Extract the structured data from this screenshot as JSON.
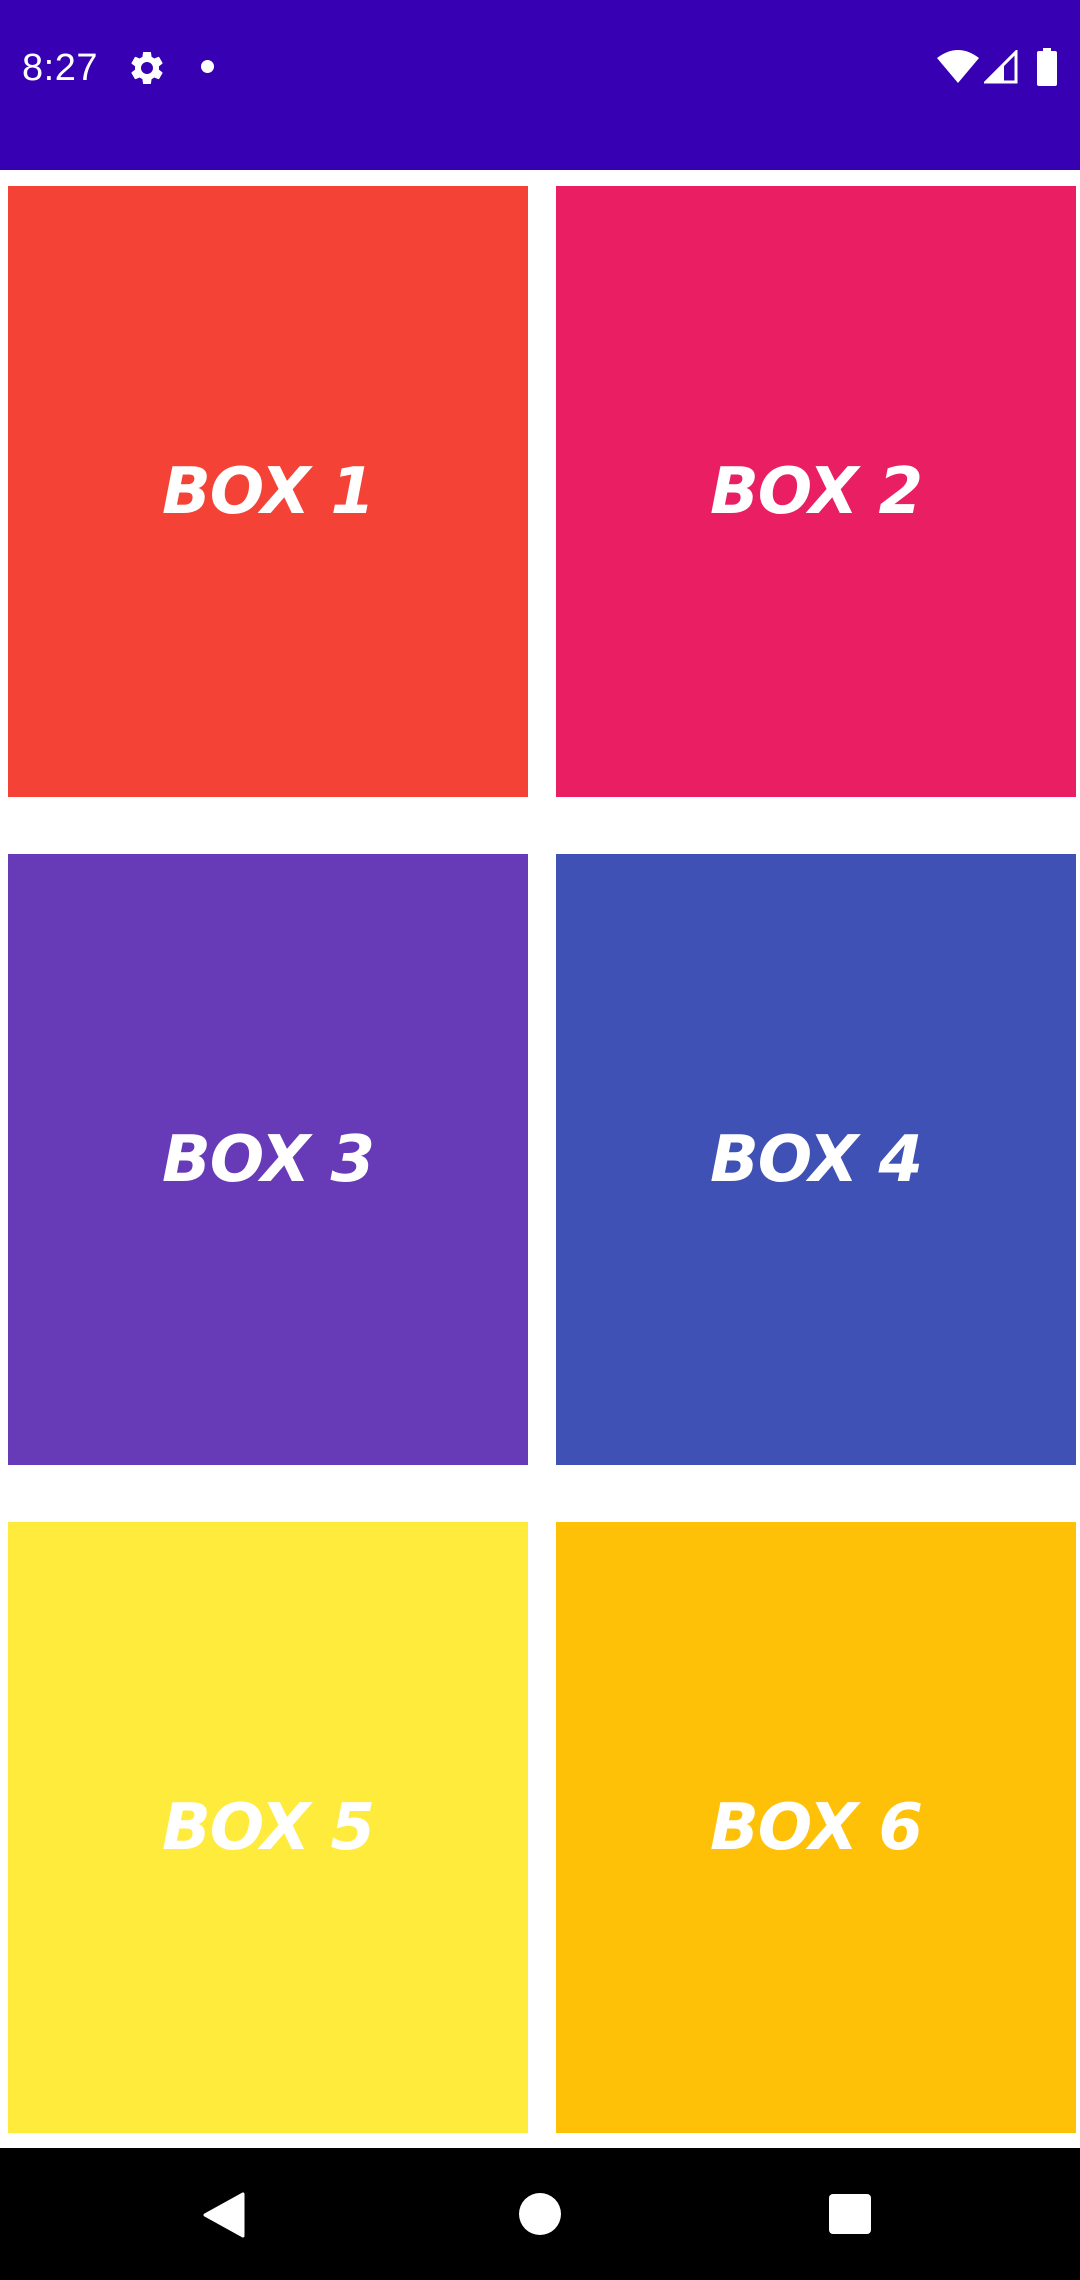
{
  "status_bar": {
    "time": "8:27",
    "icons": [
      "gear-icon",
      "notification-dot-icon",
      "wifi-icon",
      "cell-signal-icon",
      "battery-icon"
    ],
    "background": "#3700b3"
  },
  "boxes": [
    {
      "label": "BOX 1",
      "color": "#f44336"
    },
    {
      "label": "BOX 2",
      "color": "#e91e63"
    },
    {
      "label": "BOX 3",
      "color": "#673ab7"
    },
    {
      "label": "BOX 4",
      "color": "#3f51b5"
    },
    {
      "label": "BOX 5",
      "color": "#ffeb3b"
    },
    {
      "label": "BOX 6",
      "color": "#ffc107"
    }
  ],
  "nav_bar": {
    "icons": [
      "back-icon",
      "home-icon",
      "recents-icon"
    ]
  }
}
